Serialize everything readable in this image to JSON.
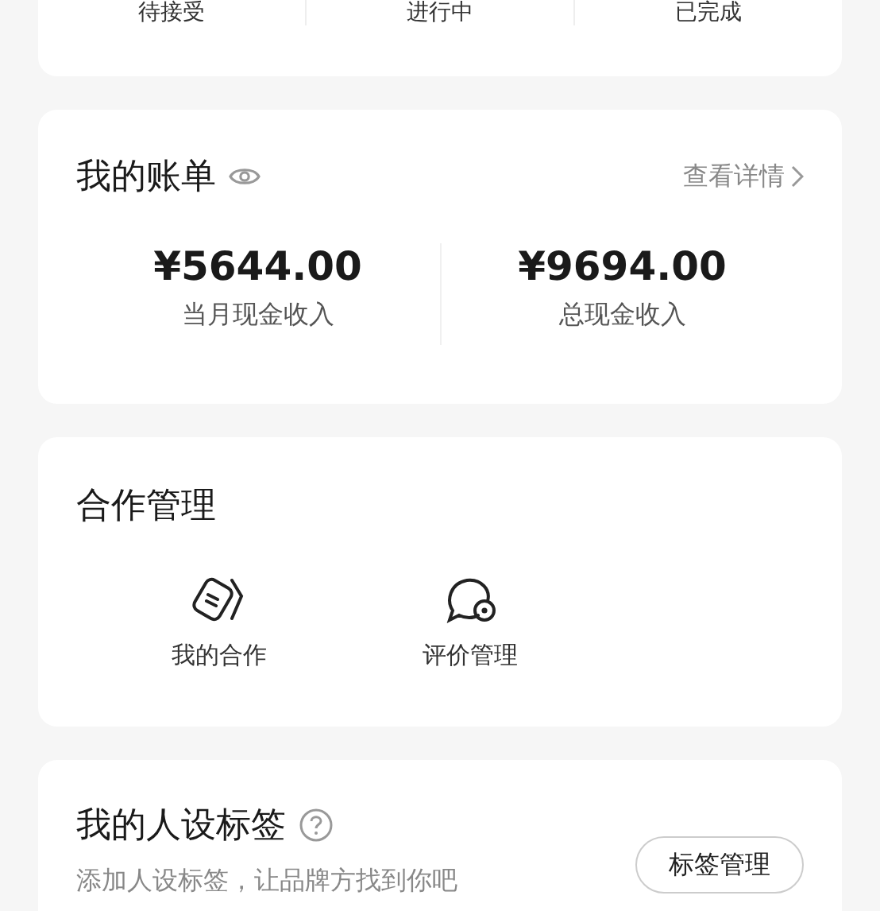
{
  "order_tabs": [
    {
      "label": "待接受"
    },
    {
      "label": "进行中"
    },
    {
      "label": "已完成"
    }
  ],
  "bill": {
    "title": "我的账单",
    "details_link": "查看详情",
    "stats": [
      {
        "amount": "¥5644.00",
        "label": "当月现金收入"
      },
      {
        "amount": "¥9694.00",
        "label": "总现金收入"
      }
    ]
  },
  "cooperation": {
    "title": "合作管理",
    "entries": [
      {
        "kind": "cards",
        "label": "我的合作"
      },
      {
        "kind": "chat",
        "label": "评价管理"
      }
    ]
  },
  "tags": {
    "title": "我的人设标签",
    "subtitle": "添加人设标签，让品牌方找到你吧",
    "button": "标签管理"
  }
}
